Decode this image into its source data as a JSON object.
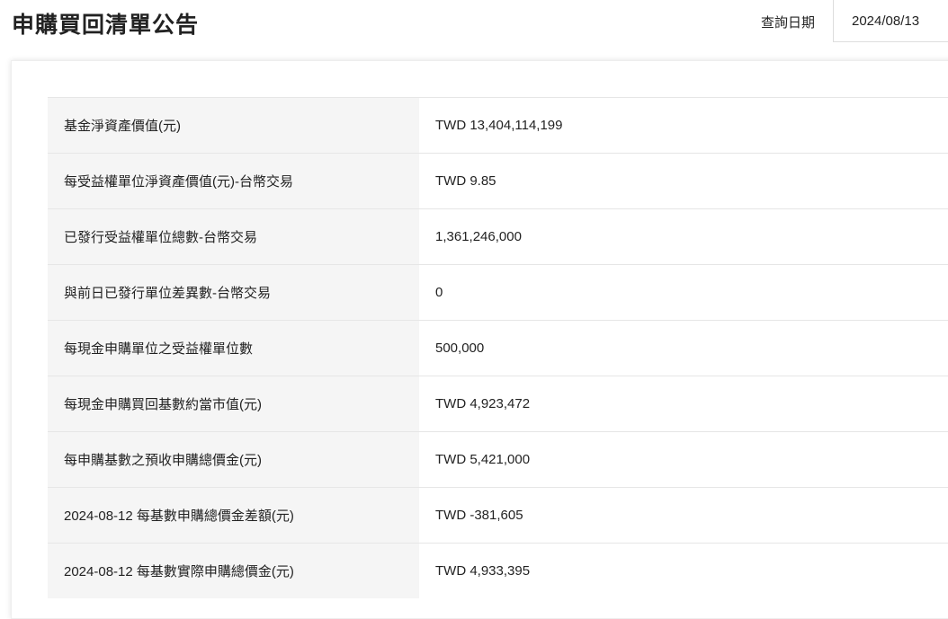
{
  "header": {
    "title": "申購買回清單公告",
    "date_label": "查詢日期",
    "date_value": "2024/08/13"
  },
  "rows": [
    {
      "label": "基金淨資產價值(元)",
      "value": "TWD 13,404,114,199"
    },
    {
      "label": "每受益權單位淨資產價值(元)-台幣交易",
      "value": "TWD 9.85"
    },
    {
      "label": "已發行受益權單位總數-台幣交易",
      "value": "1,361,246,000"
    },
    {
      "label": "與前日已發行單位差異數-台幣交易",
      "value": "0"
    },
    {
      "label": "每現金申購單位之受益權單位數",
      "value": "500,000"
    },
    {
      "label": "每現金申購買回基數約當市值(元)",
      "value": "TWD 4,923,472"
    },
    {
      "label": "每申購基數之預收申購總價金(元)",
      "value": "TWD 5,421,000"
    },
    {
      "label": "2024-08-12  每基數申購總價金差額(元)",
      "value": "TWD -381,605"
    },
    {
      "label": "2024-08-12  每基數實際申購總價金(元)",
      "value": "TWD 4,933,395"
    }
  ]
}
